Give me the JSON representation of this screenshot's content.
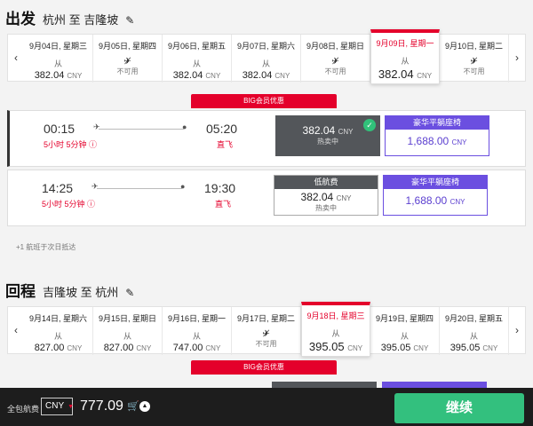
{
  "outbound": {
    "title": "出发",
    "route": "杭州 至 吉隆坡",
    "dates": [
      {
        "date": "9月04日, 星期三",
        "from": "从",
        "price": "382.04",
        "cur": "CNY"
      },
      {
        "date": "9月05日, 星期四",
        "na": "不可用"
      },
      {
        "date": "9月06日, 星期五",
        "from": "从",
        "price": "382.04",
        "cur": "CNY"
      },
      {
        "date": "9月07日, 星期六",
        "from": "从",
        "price": "382.04",
        "cur": "CNY"
      },
      {
        "date": "9月08日, 星期日",
        "na": "不可用"
      },
      {
        "date": "9月09日, 星期一",
        "from": "从",
        "price": "382.04",
        "cur": "CNY",
        "selected": true
      },
      {
        "date": "9月10日, 星期二",
        "na": "不可用"
      }
    ],
    "promo": "BIG会员优惠",
    "flights": [
      {
        "dep": "00:15",
        "arr": "05:20",
        "duration": "5小时 5分钟",
        "direct": "直飞",
        "fare1": {
          "price": "382.04",
          "cur": "CNY",
          "status": "热卖中"
        },
        "fare2": {
          "header": "豪华平躺座椅",
          "price": "1,688.00",
          "cur": "CNY"
        }
      },
      {
        "dep": "14:25",
        "arr": "19:30",
        "duration": "5小时 5分钟",
        "direct": "直飞",
        "fare1": {
          "header": "低航费",
          "price": "382.04",
          "cur": "CNY",
          "status": "热卖中"
        },
        "fare2": {
          "header": "豪华平躺座椅",
          "price": "1,688.00",
          "cur": "CNY"
        }
      }
    ],
    "note": "+1 航班于次日抵达"
  },
  "return": {
    "title": "回程",
    "route": "吉隆坡 至 杭州",
    "dates": [
      {
        "date": "9月14日, 星期六",
        "from": "从",
        "price": "827.00",
        "cur": "CNY"
      },
      {
        "date": "9月15日, 星期日",
        "from": "从",
        "price": "827.00",
        "cur": "CNY"
      },
      {
        "date": "9月16日, 星期一",
        "from": "从",
        "price": "747.00",
        "cur": "CNY"
      },
      {
        "date": "9月17日, 星期二",
        "na": "不可用"
      },
      {
        "date": "9月18日, 星期三",
        "from": "从",
        "price": "395.05",
        "cur": "CNY",
        "selected": true
      },
      {
        "date": "9月19日, 星期四",
        "from": "从",
        "price": "395.05",
        "cur": "CNY"
      },
      {
        "date": "9月20日, 星期五",
        "from": "从",
        "price": "395.05",
        "cur": "CNY"
      }
    ],
    "promo": "BIG会员优惠"
  },
  "footer": {
    "label": "全包航费",
    "currency": "CNY",
    "total": "777.09",
    "continue": "继续"
  }
}
